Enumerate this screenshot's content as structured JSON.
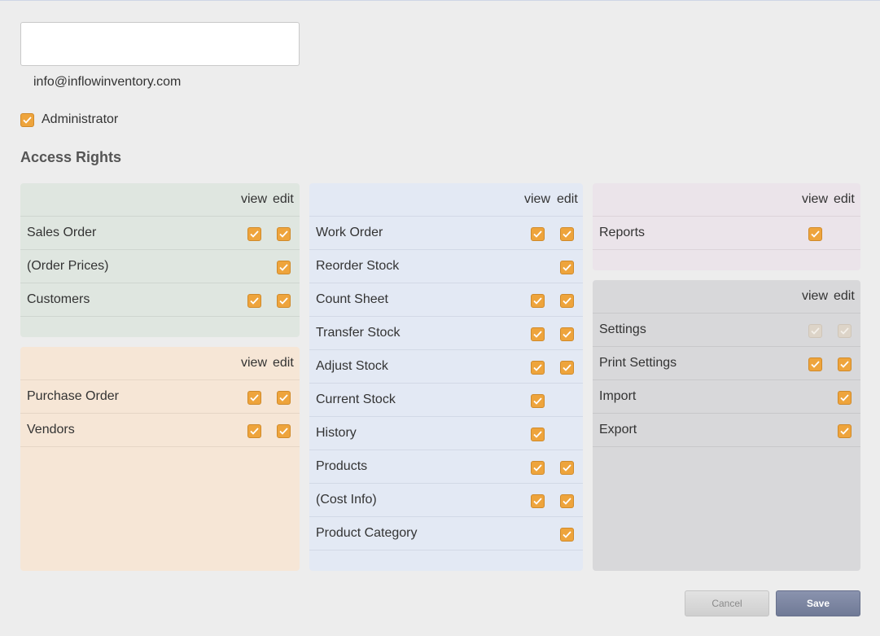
{
  "form": {
    "name_value": "",
    "email": "info@inflowinventory.com",
    "administrator_label": "Administrator",
    "administrator_checked": true,
    "access_rights_title": "Access Rights"
  },
  "columns": {
    "view": "view",
    "edit": "edit"
  },
  "panels": {
    "sales": {
      "color": "#dfe6e0",
      "rows": [
        {
          "label": "Sales Order",
          "view": true,
          "edit": true
        },
        {
          "label": "(Order Prices)",
          "view": null,
          "edit": true
        },
        {
          "label": "Customers",
          "view": true,
          "edit": true
        }
      ]
    },
    "purchasing": {
      "color": "#f6e6d6",
      "rows": [
        {
          "label": "Purchase Order",
          "view": true,
          "edit": true
        },
        {
          "label": "Vendors",
          "view": true,
          "edit": true
        }
      ]
    },
    "inventory": {
      "color": "#e3e9f4",
      "rows": [
        {
          "label": "Work Order",
          "view": true,
          "edit": true
        },
        {
          "label": "Reorder Stock",
          "view": null,
          "edit": true
        },
        {
          "label": "Count Sheet",
          "view": true,
          "edit": true
        },
        {
          "label": "Transfer Stock",
          "view": true,
          "edit": true
        },
        {
          "label": "Adjust Stock",
          "view": true,
          "edit": true
        },
        {
          "label": "Current Stock",
          "view": true,
          "edit": null
        },
        {
          "label": "History",
          "view": true,
          "edit": null
        },
        {
          "label": "Products",
          "view": true,
          "edit": true
        },
        {
          "label": "(Cost Info)",
          "view": true,
          "edit": true
        },
        {
          "label": "Product Category",
          "view": null,
          "edit": true
        }
      ]
    },
    "reports": {
      "color": "#ebe4ea",
      "rows": [
        {
          "label": "Reports",
          "view": true,
          "edit": null
        }
      ]
    },
    "settings": {
      "color": "#d8d8da",
      "rows": [
        {
          "label": "Settings",
          "view": "disabled",
          "edit": "disabled"
        },
        {
          "label": "Print Settings",
          "view": true,
          "edit": true
        },
        {
          "label": "Import",
          "view": null,
          "edit": true
        },
        {
          "label": "Export",
          "view": null,
          "edit": true
        }
      ]
    }
  },
  "buttons": {
    "cancel": "Cancel",
    "save": "Save"
  },
  "colors": {
    "checkbox": "#eea43c",
    "save_button": "#7a839f"
  }
}
